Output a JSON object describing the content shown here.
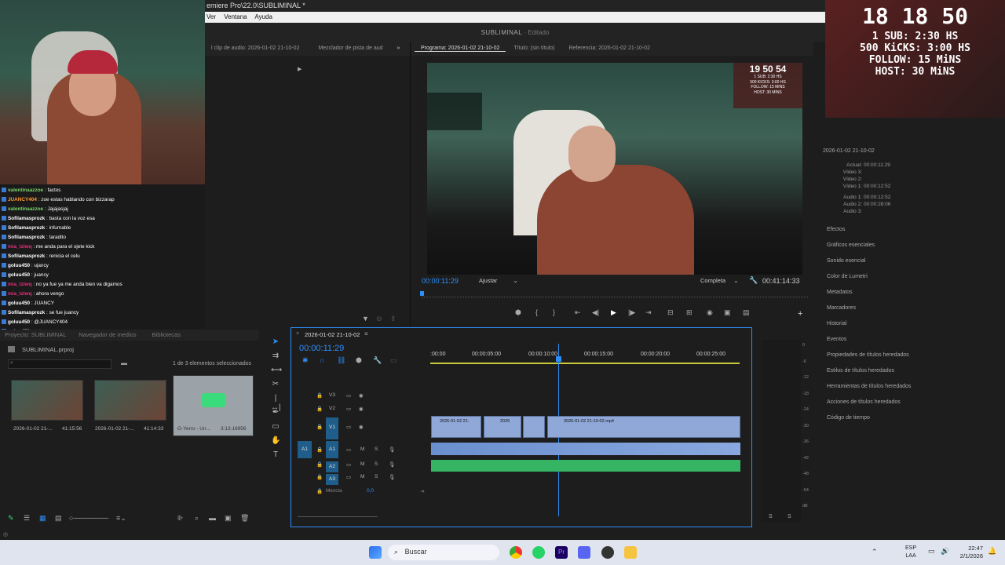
{
  "window": {
    "title": "emiere Pro\\22.0\\SUBLIMINAL *",
    "menu": [
      "Ver",
      "Ventana",
      "Ayuda"
    ]
  },
  "workspace": {
    "project": "SUBLIMINAL",
    "state": "Editado"
  },
  "source_tabs": [
    "l clip de audio: 2026-01-02 21-10-02",
    "Mezclador de pista de aud"
  ],
  "program_tabs": [
    "Programa: 2026-01-02 21-10-02",
    "Título: (sin título)",
    "Referencia: 2026-01-02 21-10-02"
  ],
  "program": {
    "timecode": "00:00:11:29",
    "fit": "Ajustar",
    "quality": "Completa",
    "duration": "00:41:14:33"
  },
  "video_overlay": {
    "timer": "19 50 54",
    "lines": [
      "1 SUB: 2:30 HS",
      "500 KICKS: 3:00 HS",
      "FOLLOW: 15 MINS",
      "HOST: 30 MINS"
    ]
  },
  "top_overlay": {
    "timer": "18 18 50",
    "lines": [
      "1 SUB: 2:30 HS",
      "500 KiCKS: 3:00 HS",
      "FOLLOW: 15 MiNS",
      "HOST: 30 MiNS"
    ]
  },
  "chat": [
    {
      "user": "valentinaazzoe",
      "color": "#7bd36b",
      "msg": "factos"
    },
    {
      "user": "JUANCY404",
      "color": "#ff9a2e",
      "msg": "zoe estas hablando con bizzarap"
    },
    {
      "user": "valentinaazzoe",
      "color": "#7bd36b",
      "msg": "Jajajasjaj"
    },
    {
      "user": "Sofilamasprozk",
      "color": "#ffffff",
      "msg": "basta con la voz esa"
    },
    {
      "user": "Sofilamasprozk",
      "color": "#ffffff",
      "msg": "infumable"
    },
    {
      "user": "Sofilamasprozk",
      "color": "#ffffff",
      "msg": "taradito"
    },
    {
      "user": "mia_tziwq",
      "color": "#e0307a",
      "msg": "me anda para el ojete kick"
    },
    {
      "user": "Sofilamasprozk",
      "color": "#ffffff",
      "msg": "renicia el celu"
    },
    {
      "user": "goluu450",
      "color": "#ffffff",
      "msg": "ujancy"
    },
    {
      "user": "goluu450",
      "color": "#ffffff",
      "msg": "juancy"
    },
    {
      "user": "mia_tziwq",
      "color": "#e0307a",
      "msg": "no ya fue ya me anda bien va digamos"
    },
    {
      "user": "mia_tziwq",
      "color": "#e0307a",
      "msg": "ahora vengo"
    },
    {
      "user": "goluu450",
      "color": "#ffffff",
      "msg": "JUANCY"
    },
    {
      "user": "Sofilamasprozk",
      "color": "#ffffff",
      "msg": "se fue juancy"
    },
    {
      "user": "goluu450",
      "color": "#ffffff",
      "msg": "@JUANCY404"
    },
    {
      "user": "goluu450",
      "color": "#ffffff",
      "msg": "esta"
    }
  ],
  "project_panel": {
    "tabs": [
      "Proyecto: SUBLIMINAL",
      "Navegador de medios",
      "Bibliotecas"
    ],
    "file": "SUBLIMINAL.prproj",
    "selection": "1 de 3 elementos seleccionados",
    "items": [
      {
        "name": "2026-01-02 21-...",
        "dur": "41:15:56"
      },
      {
        "name": "2026-01-02 21-...",
        "dur": "41:14:33"
      },
      {
        "name": "G-Yerro - Un...",
        "dur": "3:13:16956"
      }
    ]
  },
  "timeline": {
    "sequence": "2026-01-02 21-10-02",
    "timecode": "00:00:11:29",
    "ruler": [
      ":00:00",
      "00:00:05:00",
      "00:00:10:00",
      "00:00:15:00",
      "00:00:20:00",
      "00:00:25:00"
    ],
    "tracks": [
      "V3",
      "V2",
      "V1",
      "A1",
      "A2",
      "A3"
    ],
    "mix_label": "Mezcla",
    "mix_value": "0,0",
    "clip_labels": [
      "2026-01-02 21-",
      "2026",
      "2026-01-02 21-10-02.mp4"
    ]
  },
  "meter_scale": [
    "0",
    "-6",
    "-12",
    "-18",
    "-24",
    "-30",
    "-36",
    "-42",
    "-48",
    "-54",
    "dB"
  ],
  "meter_solo": [
    "S",
    "S"
  ],
  "info_panel": {
    "sequence": "2026-01-02 21-10-02",
    "rows": [
      {
        "k": "Actual:",
        "v": "00:00:11:29"
      },
      {
        "k": "Vídeo 3:",
        "v": ""
      },
      {
        "k": "Vídeo 2:",
        "v": ""
      },
      {
        "k": "Vídeo 1:",
        "v": "00:00:12:52"
      },
      {
        "k": "Audio 1:",
        "v": "00:00:12:52"
      },
      {
        "k": "Audio 2:",
        "v": "00:00:28:06"
      },
      {
        "k": "Audio 3:",
        "v": ""
      }
    ]
  },
  "right_panels": [
    "Efectos",
    "Gráficos esenciales",
    "Sonido esencial",
    "Color de Lumetri",
    "Metadatos",
    "Marcadores",
    "Historial",
    "Eventos",
    "Propiedades de títulos heredados",
    "Estilos de títulos heredados",
    "Herramientas de títulos heredados",
    "Acciones de títulos heredados",
    "Código de tiempo"
  ],
  "taskbar": {
    "search": "Buscar",
    "lang1": "ESP",
    "lang2": "LAA",
    "time": "22:47",
    "date": "2/1/2026"
  }
}
